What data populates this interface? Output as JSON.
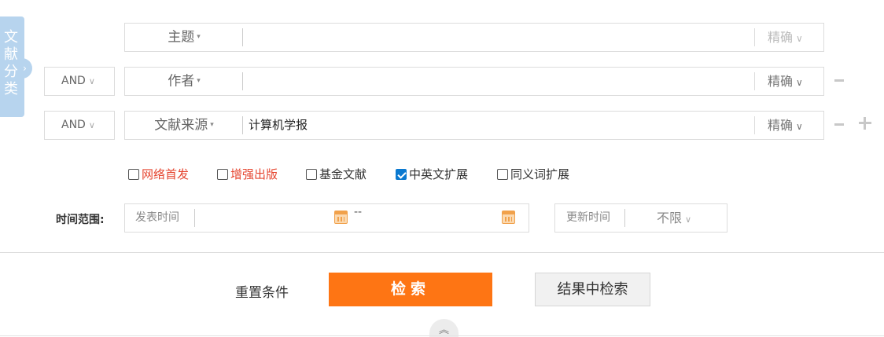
{
  "side_panel": {
    "label": "文献分类",
    "arrow_icon": "chevron-right-icon"
  },
  "search_rows": [
    {
      "logic": null,
      "field": "主题",
      "value": "",
      "match": "精确",
      "match_disabled": true
    },
    {
      "logic": "AND",
      "field": "作者",
      "value": "",
      "match": "精确"
    },
    {
      "logic": "AND",
      "field": "文献来源",
      "value": "计算机学报",
      "match": "精确"
    }
  ],
  "caret_down": "▾",
  "chevron_down": "∨",
  "options": [
    {
      "label": "网络首发",
      "checked": false,
      "color": "#e5452f"
    },
    {
      "label": "增强出版",
      "checked": false,
      "color": "#e5452f"
    },
    {
      "label": "基金文献",
      "checked": false
    },
    {
      "label": "中英文扩展",
      "checked": true
    },
    {
      "label": "同义词扩展",
      "checked": false
    }
  ],
  "time_range": {
    "label": "时间范围:",
    "publish_label": "发表时间",
    "separator": "--",
    "update_label": "更新时间",
    "update_value": "不限"
  },
  "actions": {
    "reset": "重置条件",
    "search": "检索",
    "search_color": "#fe7514",
    "search_in_results": "结果中检索"
  },
  "collapse": {
    "icon": "double-chevron-up-icon",
    "glyph": "︽"
  }
}
